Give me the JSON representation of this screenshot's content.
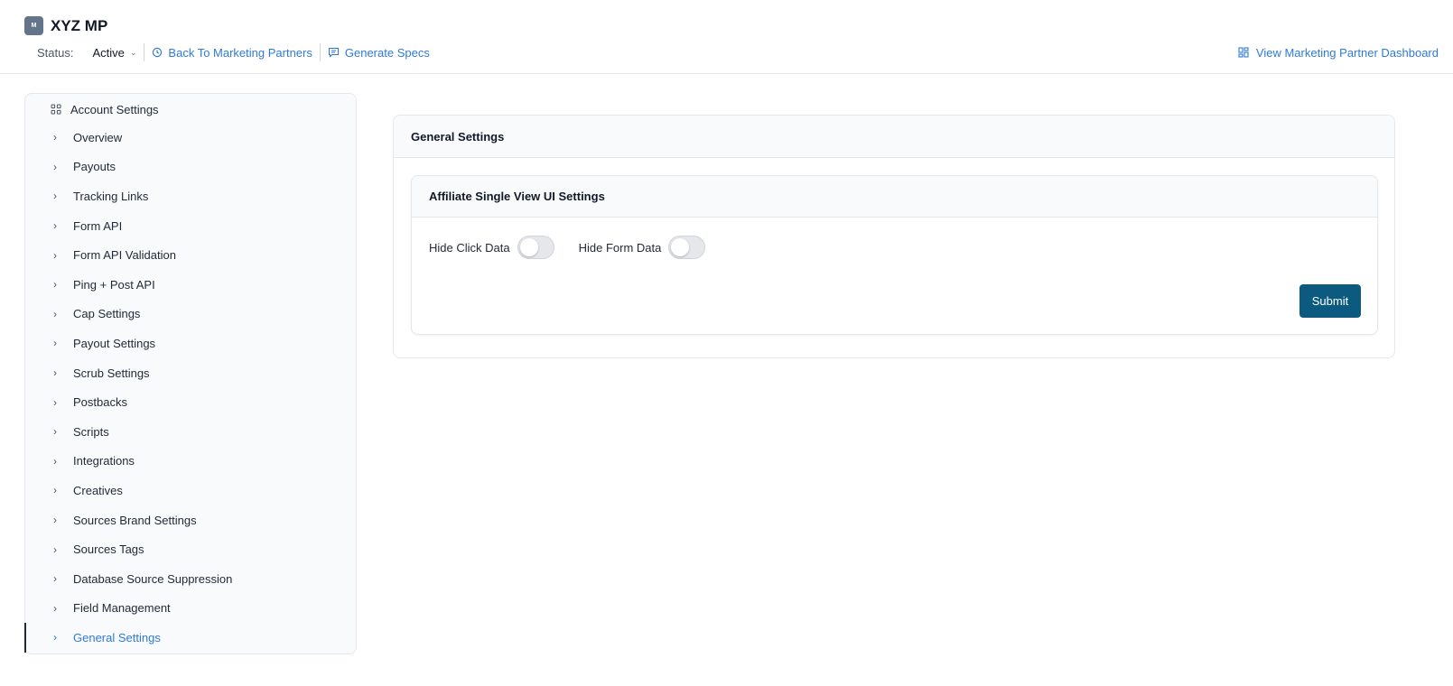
{
  "header": {
    "avatar_text": "M",
    "title": "XYZ MP",
    "status_label": "Status:",
    "status_value": "Active",
    "back_link": "Back To Marketing Partners",
    "specs_link": "Generate Specs",
    "dashboard_link": "View Marketing Partner Dashboard"
  },
  "sidebar": {
    "header": "Account Settings",
    "items": [
      {
        "label": "Overview"
      },
      {
        "label": "Payouts"
      },
      {
        "label": "Tracking Links"
      },
      {
        "label": "Form API"
      },
      {
        "label": "Form API Validation"
      },
      {
        "label": "Ping + Post API"
      },
      {
        "label": "Cap Settings"
      },
      {
        "label": "Payout Settings"
      },
      {
        "label": "Scrub Settings"
      },
      {
        "label": "Postbacks"
      },
      {
        "label": "Scripts"
      },
      {
        "label": "Integrations"
      },
      {
        "label": "Creatives"
      },
      {
        "label": "Sources Brand Settings"
      },
      {
        "label": "Sources Tags"
      },
      {
        "label": "Database Source Suppression"
      },
      {
        "label": "Field Management"
      },
      {
        "label": "General Settings",
        "active": true
      }
    ]
  },
  "main": {
    "panel_title": "General Settings",
    "card_title": "Affiliate Single View UI Settings",
    "toggles": [
      {
        "label": "Hide Click Data",
        "on": false
      },
      {
        "label": "Hide Form Data",
        "on": false
      }
    ],
    "submit_label": "Submit"
  },
  "colors": {
    "link": "#2f7ad8",
    "primary_button": "#0d5a80",
    "panel_header_bg": "#f8fafc",
    "border": "#e5e7eb"
  }
}
